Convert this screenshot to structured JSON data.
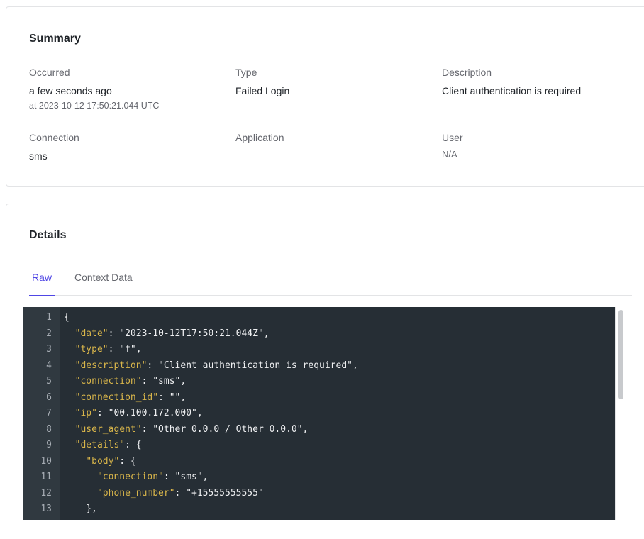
{
  "summary": {
    "title": "Summary",
    "occurred": {
      "label": "Occurred",
      "value": "a few seconds ago",
      "sub": "at 2023-10-12 17:50:21.044 UTC"
    },
    "type": {
      "label": "Type",
      "value": "Failed Login"
    },
    "description": {
      "label": "Description",
      "value": "Client authentication is required"
    },
    "connection": {
      "label": "Connection",
      "value": "sms"
    },
    "application": {
      "label": "Application",
      "value": ""
    },
    "user": {
      "label": "User",
      "value": "N/A"
    }
  },
  "details": {
    "title": "Details",
    "tabs": [
      {
        "label": "Raw",
        "active": true
      },
      {
        "label": "Context Data",
        "active": false
      }
    ],
    "code_lines": [
      {
        "n": "1",
        "indent": "",
        "key": "",
        "rest": "{"
      },
      {
        "n": "2",
        "indent": "  ",
        "key": "\"date\"",
        "rest": ": \"2023-10-12T17:50:21.044Z\","
      },
      {
        "n": "3",
        "indent": "  ",
        "key": "\"type\"",
        "rest": ": \"f\","
      },
      {
        "n": "4",
        "indent": "  ",
        "key": "\"description\"",
        "rest": ": \"Client authentication is required\","
      },
      {
        "n": "5",
        "indent": "  ",
        "key": "\"connection\"",
        "rest": ": \"sms\","
      },
      {
        "n": "6",
        "indent": "  ",
        "key": "\"connection_id\"",
        "rest": ": \"\","
      },
      {
        "n": "7",
        "indent": "  ",
        "key": "\"ip\"",
        "rest": ": \"00.100.172.000\","
      },
      {
        "n": "8",
        "indent": "  ",
        "key": "\"user_agent\"",
        "rest": ": \"Other 0.0.0 / Other 0.0.0\","
      },
      {
        "n": "9",
        "indent": "  ",
        "key": "\"details\"",
        "rest": ": {"
      },
      {
        "n": "10",
        "indent": "    ",
        "key": "\"body\"",
        "rest": ": {"
      },
      {
        "n": "11",
        "indent": "      ",
        "key": "\"connection\"",
        "rest": ": \"sms\","
      },
      {
        "n": "12",
        "indent": "      ",
        "key": "\"phone_number\"",
        "rest": ": \"+15555555555\""
      },
      {
        "n": "13",
        "indent": "    ",
        "key": "",
        "rest": "},"
      }
    ]
  },
  "colors": {
    "accent": "#4f46e5",
    "code_background": "#262e35",
    "json_key": "#d8b54a"
  }
}
